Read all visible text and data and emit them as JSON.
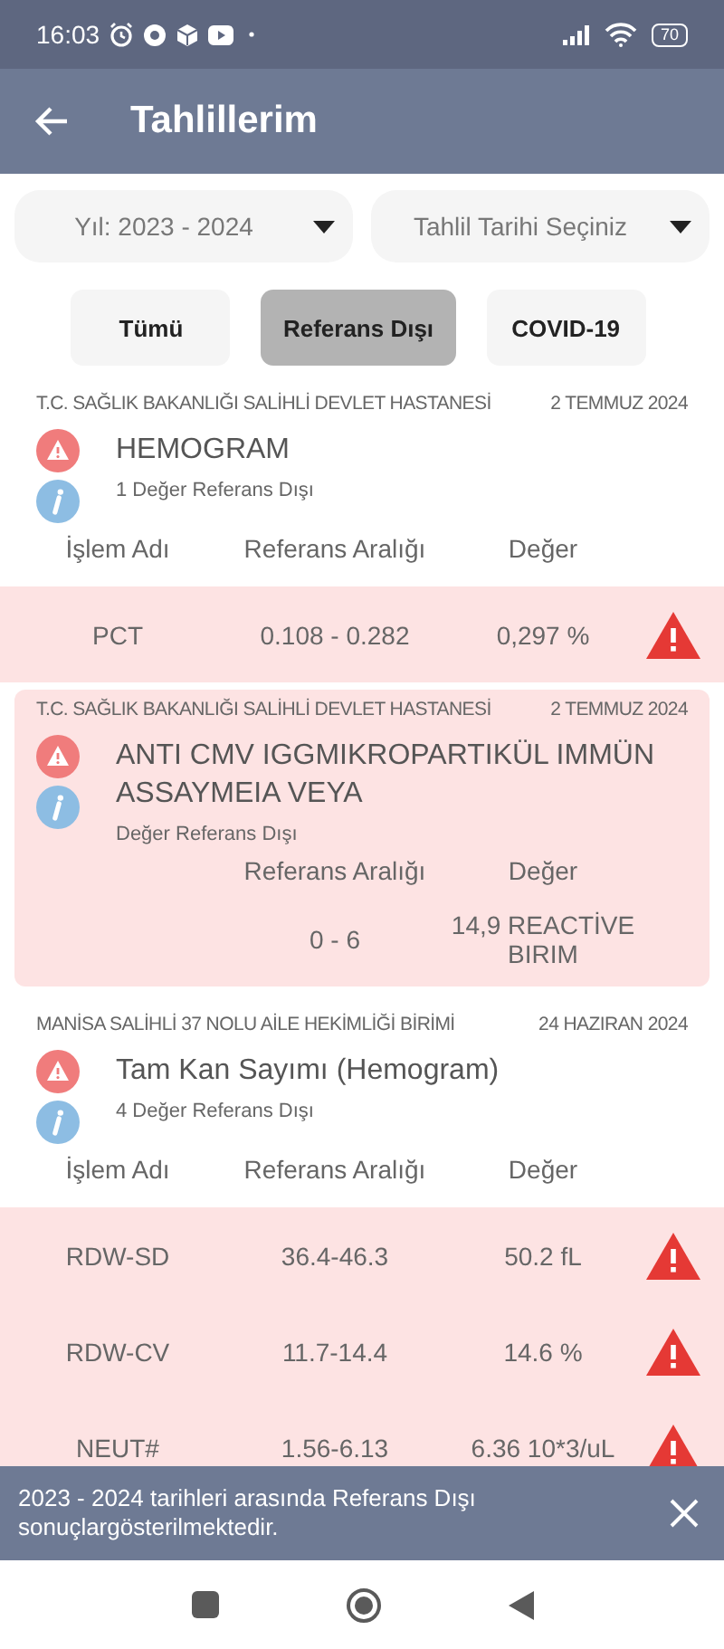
{
  "status_bar": {
    "time": "16:03",
    "battery": "70"
  },
  "app_bar": {
    "title": "Tahlillerim"
  },
  "filters": [
    {
      "value": "Yıl: 2023 - 2024"
    },
    {
      "value": "Tahlil Tarihi Seçiniz"
    }
  ],
  "chips": [
    {
      "label": "Tümü",
      "selected": false
    },
    {
      "label": "Referans Dışı",
      "selected": true
    },
    {
      "label": "COVID-19",
      "selected": false
    }
  ],
  "results": [
    {
      "institution": "T.C. SAĞLIK BAKANLIĞI SALİHLİ DEVLET HASTANESİ",
      "date": "2 TEMMUZ 2024",
      "title": "HEMOGRAM",
      "summary": "1 Değer Referans Dışı",
      "highlighted": false,
      "columns": {
        "name": "İşlem Adı",
        "range": "Referans Aralığı",
        "value": "Değer"
      },
      "rows": [
        {
          "name": "PCT",
          "range": "0.108 - 0.282",
          "value": "0,297 %",
          "warning": true
        }
      ]
    },
    {
      "institution": "T.C. SAĞLIK BAKANLIĞI SALİHLİ DEVLET HASTANESİ",
      "date": "2 TEMMUZ 2024",
      "title": "ANTI CMV IGGMIKROPARTIKÜL IMMÜN ASSAYMEIA VEYA",
      "summary": "Değer Referans Dışı",
      "highlighted": true,
      "columns": {
        "range": "Referans Aralığı",
        "value": "Değer"
      },
      "rows": [
        {
          "range": "0 - 6",
          "value": "14,9 REACTİVE BIRIM",
          "warning": false
        }
      ]
    },
    {
      "institution": "MANİSA SALİHLİ 37 NOLU AİLE HEKİMLİĞİ BİRİMİ",
      "date": "24 HAZIRAN 2024",
      "title": "Tam Kan Sayımı (Hemogram)",
      "summary": "4 Değer Referans Dışı",
      "highlighted": false,
      "columns": {
        "name": "İşlem Adı",
        "range": "Referans Aralığı",
        "value": "Değer"
      },
      "rows": [
        {
          "name": "RDW-SD",
          "range": "36.4-46.3",
          "value": "50.2 fL",
          "warning": true
        },
        {
          "name": "RDW-CV",
          "range": "11.7-14.4",
          "value": "14.6 %",
          "warning": true
        },
        {
          "name": "NEUT#",
          "range": "1.56-6.13",
          "value": "6.36 10*3/uL",
          "warning": true
        }
      ]
    }
  ],
  "snackbar": {
    "message": "2023 - 2024 tarihleri arasında Referans Dışı sonuçlargösterilmektedir."
  }
}
